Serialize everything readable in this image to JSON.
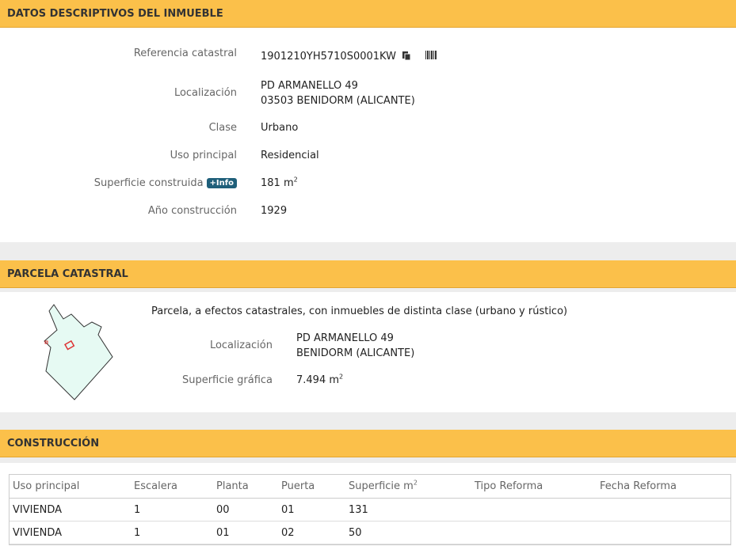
{
  "sections": {
    "inmueble": "DATOS DESCRIPTIVOS DEL INMUEBLE",
    "parcela": "PARCELA CATASTRAL",
    "construccion": "CONSTRUCCIÓN"
  },
  "inmueble": {
    "ref_label": "Referencia catastral",
    "ref_value": "1901210YH5710S0001KW",
    "loc_label": "Localización",
    "loc_line1": "PD ARMANELLO 49",
    "loc_line2": "03503 BENIDORM (ALICANTE)",
    "clase_label": "Clase",
    "clase_value": "Urbano",
    "uso_label": "Uso principal",
    "uso_value": "Residencial",
    "sup_label": "Superficie construida",
    "info_badge": "+Info",
    "sup_value": "181 m",
    "sup_unit_sup": "2",
    "anio_label": "Año construcción",
    "anio_value": "1929"
  },
  "parcela": {
    "desc": "Parcela, a efectos catastrales, con inmuebles de distinta clase (urbano y rústico)",
    "loc_label": "Localización",
    "loc_line1": "PD ARMANELLO 49",
    "loc_line2": "BENIDORM (ALICANTE)",
    "sup_label": "Superficie gráfica",
    "sup_value": "7.494 m",
    "sup_unit_sup": "2"
  },
  "construccion": {
    "headers": [
      "Uso principal",
      "Escalera",
      "Planta",
      "Puerta",
      "Superficie m",
      "Tipo Reforma",
      "Fecha Reforma"
    ],
    "header_sup": "2",
    "rows": [
      [
        "VIVIENDA",
        "1",
        "00",
        "01",
        "131",
        "",
        ""
      ],
      [
        "VIVIENDA",
        "1",
        "01",
        "02",
        "50",
        "",
        ""
      ]
    ]
  },
  "icons": {
    "copy": "copy-icon",
    "barcode": "barcode-icon"
  },
  "colors": {
    "header_bg": "#fbc04a",
    "info_badge": "#1f5f7a",
    "parcel_fill": "#e6faf3"
  }
}
